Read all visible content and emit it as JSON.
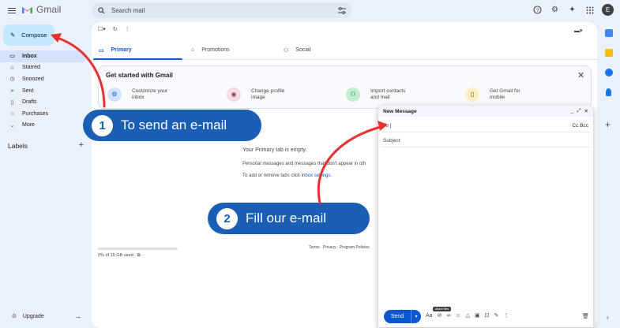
{
  "header": {
    "logo_text": "Gmail",
    "search_placeholder": "Search mail",
    "avatar_letter": "E"
  },
  "sidebar": {
    "compose_label": "Compose",
    "items": [
      {
        "label": "Inbox",
        "icon": "inbox-icon"
      },
      {
        "label": "Starred",
        "icon": "star-icon"
      },
      {
        "label": "Snoozed",
        "icon": "clock-icon"
      },
      {
        "label": "Sent",
        "icon": "send-icon"
      },
      {
        "label": "Drafts",
        "icon": "draft-icon"
      },
      {
        "label": "Purchases",
        "icon": "tag-icon"
      },
      {
        "label": "More",
        "icon": "chevron-down-icon"
      }
    ],
    "labels_heading": "Labels",
    "upgrade_label": "Upgrade"
  },
  "tabs": [
    {
      "label": "Primary"
    },
    {
      "label": "Promotions"
    },
    {
      "label": "Social"
    }
  ],
  "get_started": {
    "title": "Get started with Gmail",
    "steps": [
      {
        "line1": "Customize your",
        "line2": "inbox"
      },
      {
        "line1": "Change profile",
        "line2": "image"
      },
      {
        "line1": "Import contacts",
        "line2": "and mail"
      },
      {
        "line1": "Get Gmail for",
        "line2": "mobile"
      }
    ]
  },
  "empty_state": {
    "title": "Your Primary tab is empty.",
    "line1": "Personal messages and messages that don't appear in oth",
    "line2_prefix": "To add or remove tabs click in",
    "line2_link": "box settings."
  },
  "footer": {
    "storage": "0% of 15 GB used",
    "terms": "Terms · Privacy · Program Policies"
  },
  "compose_window": {
    "title": "New Message",
    "to_label": "To",
    "cc_bcc": "Cc Bcc",
    "subject_placeholder": "Subject",
    "send_label": "Send",
    "format_label": "Aa",
    "tooltip": "Attach files"
  },
  "callouts": [
    {
      "number": "1",
      "text": "To send an e-mail"
    },
    {
      "number": "2",
      "text": "Fill our e-mail"
    }
  ],
  "colors": {
    "accent": "#0b57d0",
    "callout": "#1a5fb4",
    "arrow": "#e8312f"
  }
}
